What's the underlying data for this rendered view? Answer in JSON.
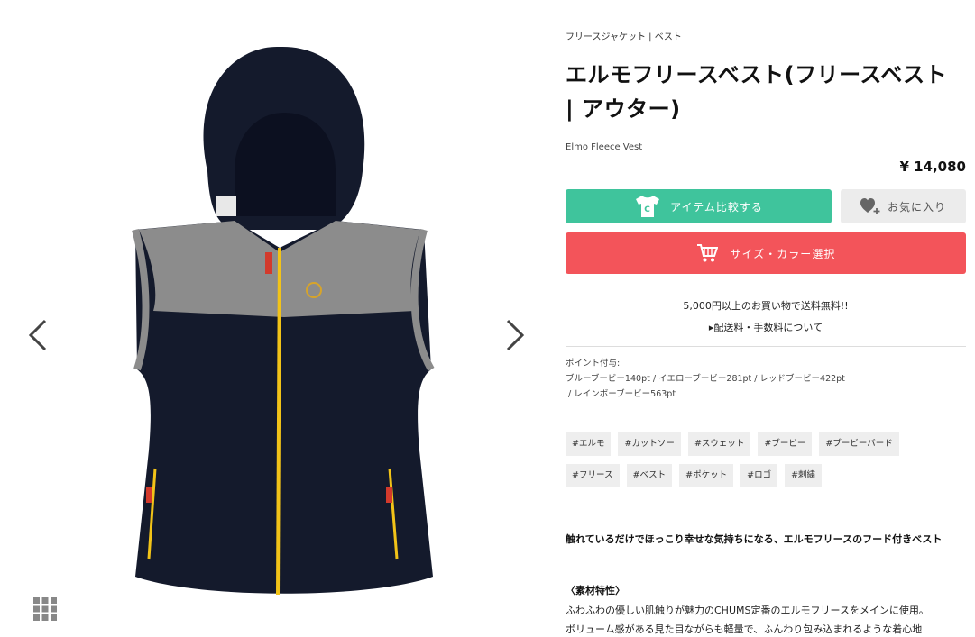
{
  "breadcrumb": "フリースジャケット | ベスト",
  "title": "エルモフリースベスト(フリースベスト | アウター)",
  "english_name": "Elmo Fleece Vest",
  "price": "¥ 14,080",
  "buttons": {
    "compare": "アイテム比較する",
    "favorite": "お気に入り",
    "select": "サイズ・カラー選択"
  },
  "shipping": {
    "free_text": "5,000円以上のお買い物で送料無料!!",
    "link_prefix": "▸",
    "link_text": "配送料・手数料について"
  },
  "points": {
    "label": "ポイント付与:",
    "line1": "ブルーブービー140pt / イエローブービー281pt / レッドブービー422pt",
    "line2": " / レインボーブービー563pt"
  },
  "tags": [
    "#エルモ",
    "#カットソー",
    "#スウェット",
    "#ブービー",
    "#ブービーバード",
    "#フリース",
    "#ベスト",
    "#ポケット",
    "#ロゴ",
    "#刺繍"
  ],
  "description": {
    "lead": "触れているだけでほっこり幸せな気持ちになる、エルモフリースのフード付きベスト",
    "heading": "〈素材特性〉",
    "line1": "ふわふわの優しい肌触りが魅力のCHUMS定番のエルモフリースをメインに使用。",
    "line2": "ボリューム感がある見た目ながらも軽量で、ふんわり包み込まれるような着心地"
  },
  "icons": {
    "prev": "chevron-left-icon",
    "next": "chevron-right-icon",
    "grid": "grid-icon",
    "compare": "tshirt-icon",
    "favorite": "heart-plus-icon",
    "cart": "cart-icon"
  },
  "colors": {
    "compare_button": "#3fc49c",
    "select_button": "#f3545a",
    "favorite_button": "#ececec",
    "vest_body": "#141a2c",
    "vest_yoke": "#8c8c8c",
    "zipper": "#f2c318"
  }
}
